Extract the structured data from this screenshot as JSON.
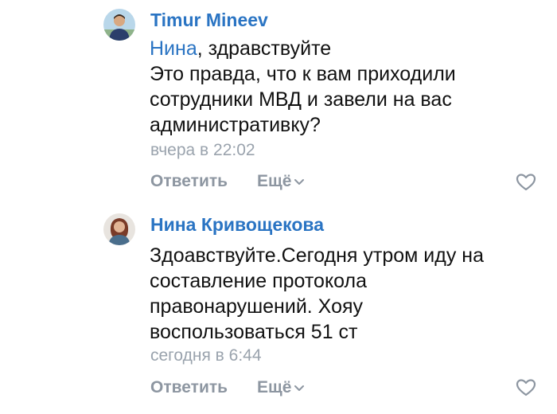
{
  "comments": [
    {
      "author": "Timur Mineev",
      "mention": "Нина",
      "lines": [
        ", здравствуйте",
        "Это правда, что к вам приходили",
        "сотрудники МВД и завели на вас",
        "административку?"
      ],
      "timestamp": "вчера в 22:02",
      "reply_label": "Ответить",
      "more_label": "Ещё"
    },
    {
      "author": "Нина Кривощекова",
      "lines": [
        "Здоавствуйте.Сегодня утром иду на",
        "составление протокола",
        "правонарушений. Хояу",
        "воспользоваться 51 ст"
      ],
      "timestamp": "сегодня в 6:44",
      "reply_label": "Ответить",
      "more_label": "Ещё"
    }
  ],
  "colors": {
    "link": "#2a74c3",
    "text": "#111111",
    "meta": "#9aa3ad",
    "action": "#8d96a1"
  },
  "icons": {
    "like": "heart-outline-icon",
    "more": "chevron-down-icon"
  }
}
